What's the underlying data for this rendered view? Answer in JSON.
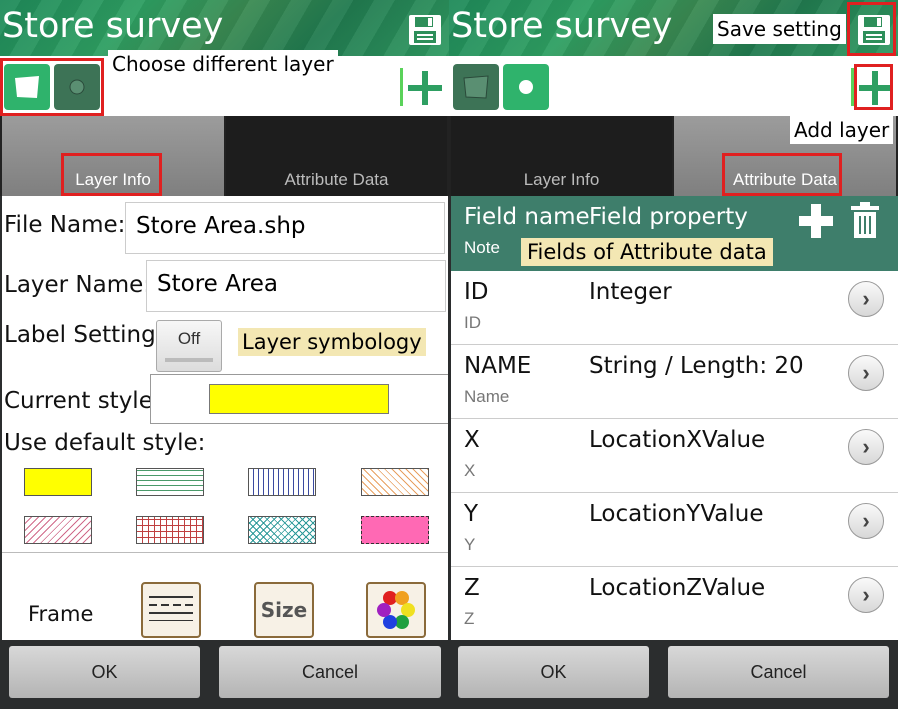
{
  "left": {
    "title": "Store survey",
    "annotation_choose_layer": "Choose different layer",
    "tabs": {
      "layer_info": "Layer Info",
      "attribute_data": "Attribute Data"
    },
    "form": {
      "file_name_label": "File Name:",
      "file_name_value": "Store Area.shp",
      "layer_name_label": "Layer Name:",
      "layer_name_value": "Store Area",
      "label_setting_label": "Label Setting:",
      "label_toggle": "Off",
      "annotation_symbology": "Layer symbology",
      "current_style_label": "Current style:",
      "current_style_color": "#ffff00",
      "use_default_label": "Use default style:",
      "frame_label": "Frame",
      "size_label": "Size"
    },
    "buttons": {
      "ok": "OK",
      "cancel": "Cancel"
    }
  },
  "right": {
    "title": "Store survey",
    "annotation_save": "Save setting",
    "annotation_add_layer": "Add layer",
    "tabs": {
      "layer_info": "Layer Info",
      "attribute_data": "Attribute Data"
    },
    "header": {
      "field_name": "Field name",
      "field_property": "Field property",
      "note": "Note",
      "annotation_fields": "Fields of Attribute data"
    },
    "rows": [
      {
        "name": "ID",
        "note": "ID",
        "prop": "Integer"
      },
      {
        "name": "NAME",
        "note": "Name",
        "prop": "String / Length: 20"
      },
      {
        "name": "X",
        "note": "X",
        "prop": "LocationXValue"
      },
      {
        "name": "Y",
        "note": "Y",
        "prop": "LocationYValue"
      },
      {
        "name": "Z",
        "note": "Z",
        "prop": "LocationZValue"
      }
    ],
    "buttons": {
      "ok": "OK",
      "cancel": "Cancel"
    }
  },
  "colors": {
    "accent": "#2e9f62",
    "annotation": "#e02020",
    "header_bg": "#3e7e6b"
  }
}
